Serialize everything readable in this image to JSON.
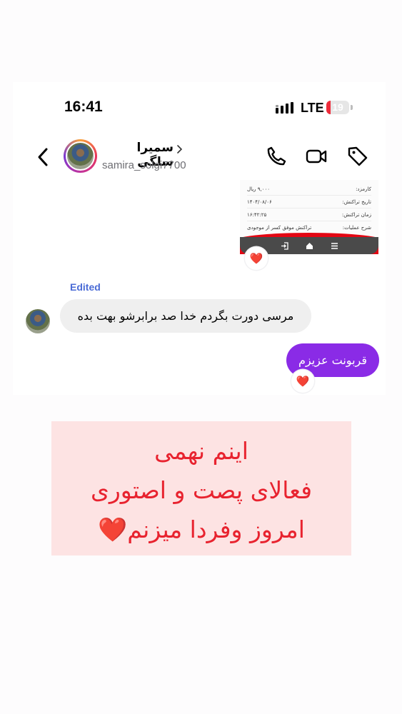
{
  "status_bar": {
    "time": "16:41",
    "network": "LTE",
    "battery_level": "19",
    "signal_icon": "signal-bars-icon"
  },
  "header": {
    "display_name": "سمیرا سلگی",
    "username": "samira_solgi7700",
    "icons": [
      "back-chevron-icon",
      "phone-icon",
      "video-camera-icon",
      "tag-icon"
    ]
  },
  "receipt": {
    "rows": [
      {
        "label": "کارمزد:",
        "value": "۹,۰۰۰ ریال"
      },
      {
        "label": "تاریخ تراکنش:",
        "value": "۱۴۰۴/۰۸/۰۶"
      },
      {
        "label": "زمان تراکنش:",
        "value": "۱۶:۴۲:۲۵"
      },
      {
        "label": "شرح عملیات:",
        "value": "تراکنش موفق کسر از موجودی"
      }
    ]
  },
  "messages": {
    "edited_label": "Edited",
    "incoming_text": "مرسی دورت بگردم خدا صد برابرشو بهت بده",
    "outgoing_text": "قربونت عزیزم",
    "reaction": "❤️"
  },
  "note": {
    "line1": "اینم نهمی",
    "line2": "فعالای پصت و اصتوری",
    "line3": "امروز وفردا میزنم❤️"
  },
  "colors": {
    "accent_purple": "#8a2be6",
    "edited_blue": "#4a6bd6",
    "note_bg": "#fde3e3",
    "note_text": "#e8232f"
  }
}
